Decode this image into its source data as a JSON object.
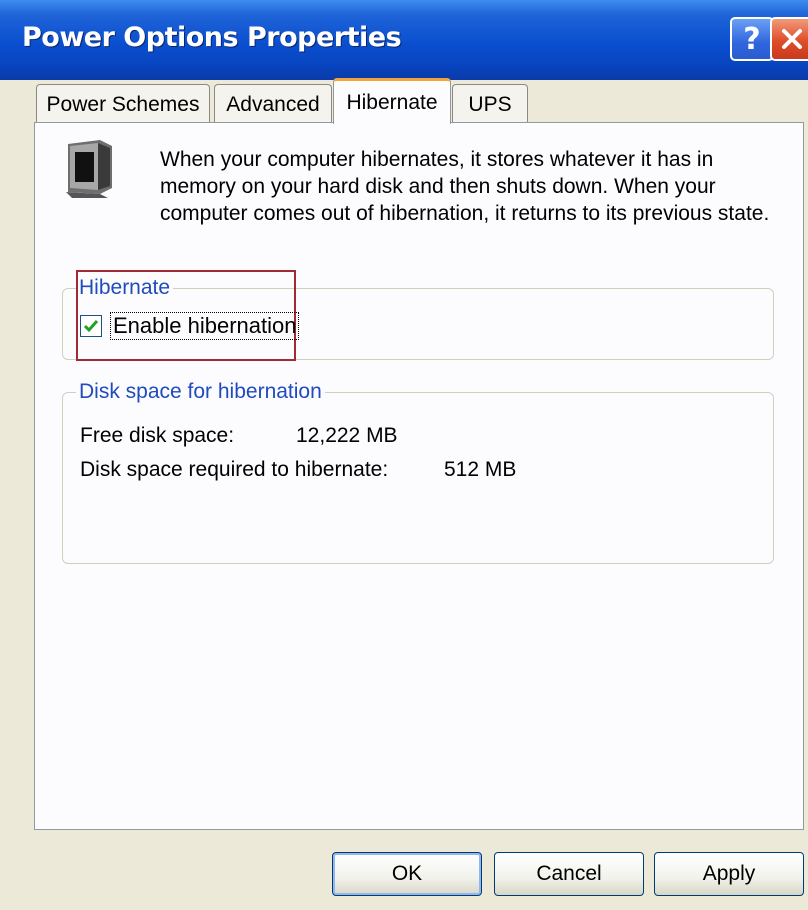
{
  "window": {
    "title": "Power Options Properties"
  },
  "caption_buttons": {
    "help": "?",
    "close": "✕"
  },
  "tabs": [
    {
      "label": "Power Schemes"
    },
    {
      "label": "Advanced"
    },
    {
      "label": "Hibernate",
      "active": true
    },
    {
      "label": "UPS"
    }
  ],
  "description": {
    "text": "When your computer hibernates, it stores whatever it has in\nmemory on your hard disk and then shuts down. When your\ncomputer comes out of hibernation, it returns to its previous state.",
    "icon": "monitor-moon-icon"
  },
  "hibernate_group": {
    "label": "Hibernate",
    "checkbox_label": "Enable hibernation",
    "checked": true
  },
  "disk_group": {
    "label": "Disk space for hibernation",
    "free_label": "Free disk space:",
    "free_value": "12,222 MB",
    "required_label": "Disk space required to hibernate:",
    "required_value": "512 MB"
  },
  "buttons": {
    "ok": "OK",
    "cancel": "Cancel",
    "apply": "Apply"
  },
  "colors": {
    "titlebar": "#0a4fcf",
    "active_tab_accent": "#f2a33a",
    "group_label": "#1f4bbf",
    "highlight": "#a02b34"
  }
}
